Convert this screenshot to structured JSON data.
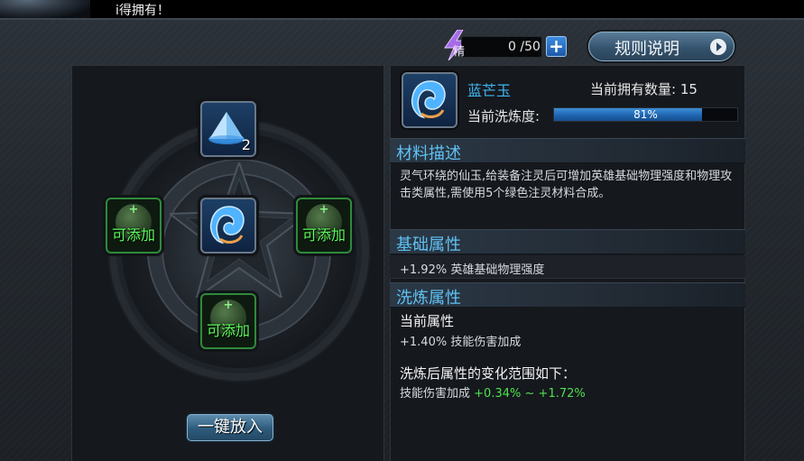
{
  "notice": {
    "text": "i得拥有！"
  },
  "energy": {
    "icon": "lightning-icon",
    "icon_char": "精",
    "value": "0 /50",
    "plus_label": "+"
  },
  "rules_button": {
    "label": "规则说明"
  },
  "slots": {
    "top_count": "2",
    "add_label": "可添加",
    "add_plus": "+"
  },
  "onekey_button": {
    "label": "一键放入"
  },
  "item": {
    "name": "蓝芒玉",
    "count_label": "当前拥有数量: 15",
    "refine_label": "当前洗炼度:",
    "refine_percent": 81,
    "refine_text": "81%"
  },
  "sections": {
    "material": {
      "title": "材料描述",
      "text": "灵气环绕的仙玉,给装备注灵后可增加英雄基础物理强度和物理攻击类属性,需使用5个绿色注灵材料合成。"
    },
    "basic": {
      "title": "基础属性",
      "text": "+1.92% 英雄基础物理强度"
    },
    "refine": {
      "title": "洗炼属性",
      "current_title": "当前属性",
      "current_text": "+1.40% 技能伤害加成",
      "range_title": "洗炼后属性的变化范围如下：",
      "range_prefix": "技能伤害加成",
      "range_min": "+0.34%",
      "range_sep": "~",
      "range_max": "+1.72%"
    }
  },
  "colors": {
    "accent_blue": "#5fc2f5",
    "item_name": "#3fb6f2",
    "add_green": "#5cff5c",
    "range_green": "#4fe04f"
  }
}
